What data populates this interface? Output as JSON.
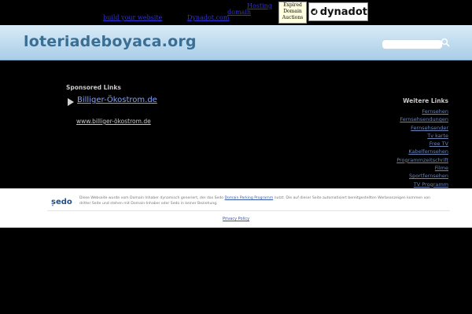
{
  "top_bar": {
    "link_build": "build your website",
    "link_dynadot": "Dynadot.com",
    "link_hosting": "Hosting",
    "link_domain": "domain",
    "expired_box": {
      "line1": "Expired",
      "line2": "Domain",
      "line3": "Auctions"
    },
    "dynadot_logo_text": "dynadot"
  },
  "header": {
    "site_title": "loteriadeboyaca.org",
    "search": {
      "value": "",
      "placeholder": ""
    }
  },
  "main": {
    "sponsored_heading": "Sponsored Links",
    "ad": {
      "title": "Billiger-Ökostrom.de",
      "url": "www.billiger-ökostrom.de"
    },
    "related_heading": "Weitere Links",
    "related_links": [
      "Fernsehen",
      "Fernsehsendungen",
      "Fernsehsender",
      "Tv karte",
      "Free TV",
      "Kabelfernsehen",
      "Programmzeitschrift",
      "Filme",
      "Sportfernsehen",
      "TV Programm"
    ]
  },
  "footer": {
    "sedo_logo": "sedo",
    "disclaimer_part1": "Diese Webseite wurde vom Domain Inhaber dynamisch generiert, der das Sedo ",
    "disclaimer_link": "Domain Parking Programm",
    "disclaimer_part2": " nutzt. Die auf dieser Seite automatisiert bereitgestellten Werbeanzeigen kommen von dritter Seite und stehen mit Domain-Inhaber oder Sedo in keiner Beziehung.",
    "privacy_policy": "Privacy Policy"
  },
  "colors": {
    "header_blue": "#a9cde7",
    "title_blue": "#3b6e93",
    "link_blue": "#7fa0ff"
  }
}
